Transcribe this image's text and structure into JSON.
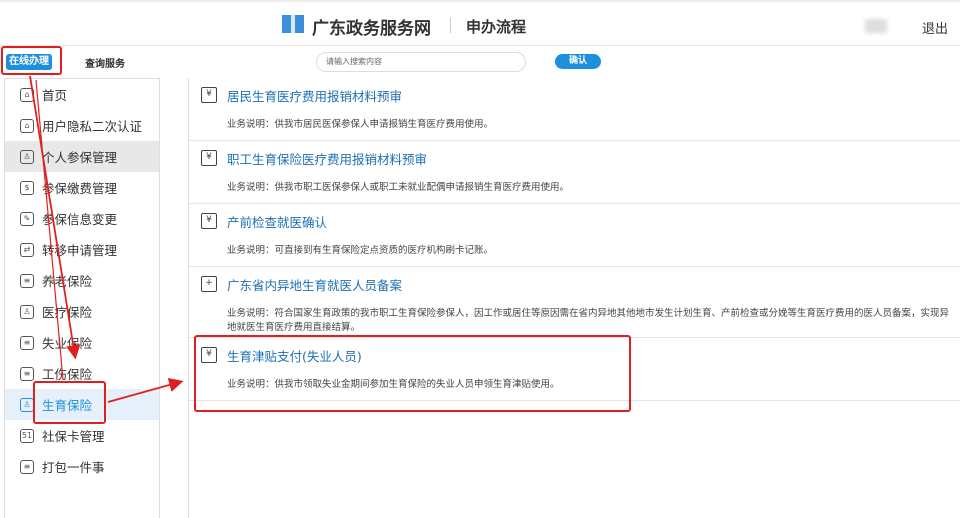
{
  "header": {
    "site_name": "广东政务服务网",
    "page_title": "申办流程",
    "logout": "退出"
  },
  "nav": {
    "tabs": [
      "在线办理",
      "查询服务"
    ],
    "search_placeholder": "请输入搜索内容",
    "confirm": "确认"
  },
  "sidebar": {
    "items": [
      "首页",
      "用户隐私二次认证",
      "个人参保管理",
      "参保缴费管理",
      "参保信息变更",
      "转移申请管理",
      "养老保险",
      "医疗保险",
      "失业保险",
      "工伤保险",
      "生育保险",
      "社保卡管理",
      "打包一件事"
    ],
    "icons": [
      "⌂",
      "⌂",
      "♙",
      "$",
      "✎",
      "⇄",
      "≡",
      "♙",
      "≡",
      "≡",
      "♙",
      "51",
      "≡"
    ]
  },
  "services": [
    {
      "title": "居民生育医疗费用报销材料预审",
      "desc": "业务说明：供我市居民医保参保人申请报销生育医疗费用使用。",
      "icon": "¥"
    },
    {
      "title": "职工生育保险医疗费用报销材料预审",
      "desc": "业务说明：供我市职工医保参保人或职工未就业配偶申请报销生育医疗费用使用。",
      "icon": "¥"
    },
    {
      "title": "产前检查就医确认",
      "desc": "业务说明：可直接到有生育保险定点资质的医疗机构刷卡记账。",
      "icon": "¥"
    },
    {
      "title": "广东省内异地生育就医人员备案",
      "desc": "业务说明：符合国家生育政策的我市职工生育保险参保人，因工作或居住等原因需在省内异地其他地市发生计划生育、产前检查或分娩等生育医疗费用的医人员备案，实现异地就医生育医疗费用直接结算。",
      "icon": "+"
    },
    {
      "title": "生育津贴支付(失业人员)",
      "desc": "业务说明：供我市领取失业金期间参加生育保险的失业人员申领生育津贴使用。",
      "icon": "¥"
    }
  ],
  "colors": {
    "accent": "#1d8fdc",
    "annotation": "#e02020"
  }
}
